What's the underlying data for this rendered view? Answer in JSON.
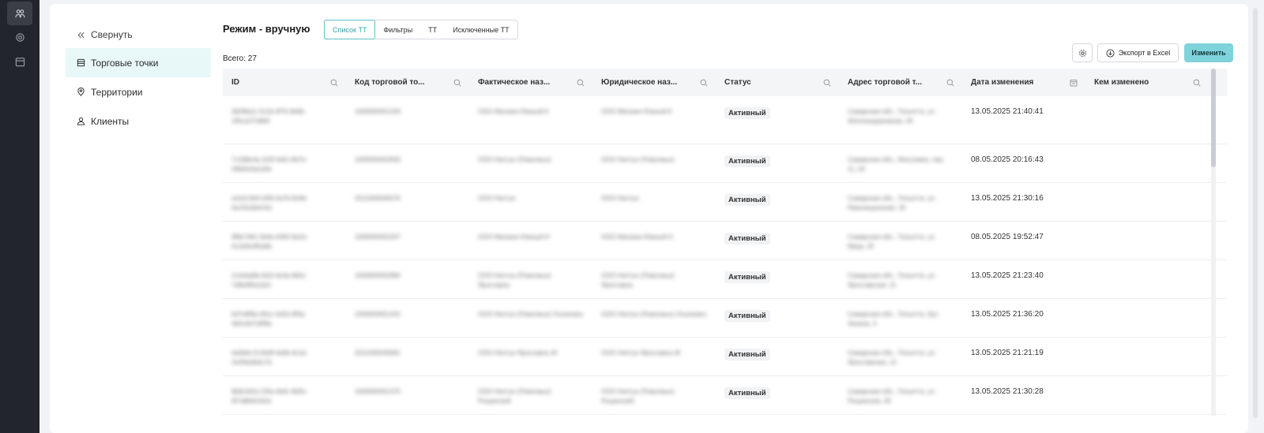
{
  "rail": {
    "items": [
      "users-icon",
      "gear-icon",
      "calendar-icon"
    ]
  },
  "nav": {
    "collapse_label": "Свернуть",
    "items": [
      {
        "label": "Торговые точки",
        "icon": "store-icon"
      },
      {
        "label": "Территории",
        "icon": "location-pin-icon"
      },
      {
        "label": "Клиенты",
        "icon": "user-icon"
      }
    ]
  },
  "header": {
    "mode_title": "Режим - вручную",
    "tabs": [
      "Список ТТ",
      "Фильтры",
      "ТТ",
      "Исключенные ТТ"
    ],
    "active_tab": "Список ТТ",
    "total": "Всего: 27",
    "export_label": "Экспорт в Excel",
    "change_label": "Изменить"
  },
  "table": {
    "columns": [
      "ID",
      "Код торговой то...",
      "Фактическое наз...",
      "Юридическое наз...",
      "Статус",
      "Адрес торговой т...",
      "Дата изменения",
      "Кем изменено"
    ],
    "rows": [
      {
        "id": "3b5f8a1c-5c2d-4f7b-9e6b-1f9ca1f7a8b6",
        "code": "1000000451234",
        "fact": "ООО Магазин Южный-К",
        "legal": "ООО Магазин Южный-К",
        "status": "Активный",
        "address": "Самарская обл., Тольятти, ул. Железнодорожная, 45",
        "date": "13.05.2025 21:40:41"
      },
      {
        "id": "7c2d8e4a-1b3f-4a5c-8d7e-2f6b9c0a1d3e",
        "code": "1000000453456",
        "fact": "ООО Нептун (Поволжье)",
        "legal": "ООО Нептун (Поволжье)",
        "status": "Активный",
        "address": "Самарская обл., Жигулевск, пер. 11, 24",
        "date": "08.05.2025 20:16:43"
      },
      {
        "id": "a1b2c3d4-e5f6-4a7b-8c9d-0e1f2a3b4c5d",
        "code": "3211000045678",
        "fact": "ООО Нептун",
        "legal": "ООО Нептун",
        "status": "Активный",
        "address": "Самарская обл., Тольятти, ул. Революционная, 18",
        "date": "13.05.2025 21:30:16"
      },
      {
        "id": "9f8e7d6c-5b4a-4392-8a1b-0c2d3e4f5a6b",
        "code": "1000000452347",
        "fact": "ООО Магазин Южный-Н",
        "legal": "ООО Магазин Южный-Н",
        "status": "Активный",
        "address": "Самарская обл., Тольятти, ул. Мира, 25",
        "date": "08.05.2025 19:52:47"
      },
      {
        "id": "2c4e6a8b-0d1f-4e3a-9b5c-7d8e9f0a1b2c",
        "code": "1000000452984",
        "fact": "ООО Нептун (Поволжье) Ярославль",
        "legal": "ООО Нептун (Поволжье) Ярославль",
        "status": "Активный",
        "address": "Самарская обл., Тольятти, ул. Ярославская, 21",
        "date": "13.05.2025 21:23:40"
      },
      {
        "id": "6d7e8f9a-0b1c-4d2e-8f3a-4b5c6d7e8f9a",
        "code": "1000000451415",
        "fact": "ООО Нептун (Поволжье) Ульяновск",
        "legal": "ООО Нептун (Поволжье) Ульяновск",
        "status": "Активный",
        "address": "Самарская обл., Тольятти, бул. Ленина, 4",
        "date": "13.05.2025 21:36:20"
      },
      {
        "id": "4a5b6c7d-8e9f-4a0b-9c1d-2e3f4a5b6c7d",
        "code": "3211000045662",
        "fact": "ООО Нептун Ярославль-М",
        "legal": "ООО Нептун Ярославль-М",
        "status": "Активный",
        "address": "Самарская обл., Тольятти, ул. Ярославская, 12",
        "date": "13.05.2025 21:21:19"
      },
      {
        "id": "8b9c0d1e-2f3a-4b4c-8d5e-6f7a8b9c0d1e",
        "code": "1000000451375",
        "fact": "ООО Нептун (Поволжье) Рощинский",
        "legal": "ООО Нептун (Поволжье) Рощинский",
        "status": "Активный",
        "address": "Самарская обл., Тольятти, ул. Рощинская, 30",
        "date": "13.05.2025 21:30:28"
      }
    ]
  }
}
